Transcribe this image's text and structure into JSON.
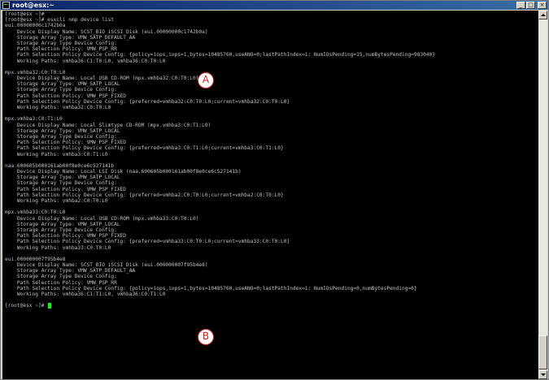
{
  "window": {
    "title": "root@esx:~",
    "buttons": {
      "minimize": "_",
      "maximize": "□",
      "close": "×"
    }
  },
  "terminal": {
    "lines": [
      "[root@esx ~]#",
      "[root@esx ~]# esxcli nmp device list",
      "eui.00000000c1742b0a",
      "    Device Display Name: SCST_BIO iSCSI Disk (eui.00000000c1742b0a)",
      "    Storage Array Type: VMW_SATP_DEFAULT_AA",
      "    Storage Array Type Device Config:",
      "    Path Selection Policy: VMW_PSP_RR",
      "    Path Selection Policy Device Config: {policy=iops,iops=1,bytes=10485760,useANO=0;lastPathIndex=1: NumIOsPending=15,numBytesPending=983040}",
      "    Working Paths: vmhba36:C1:T0:L0, vmhba36:C0:T0:L0",
      "",
      "mpx.vmhba32:C0:T0:L0",
      "    Device Display Name: Local USB CD-ROM (mpx.vmhba32:C0:T0:L0)",
      "    Storage Array Type: VMW_SATP_LOCAL",
      "    Storage Array Type Device Config:",
      "    Path Selection Policy: VMW_PSP_FIXED",
      "    Path Selection Policy Device Config: {preferred=vmhba32:C0:T0:L0;current=vmhba32:C0:T0:L0}",
      "    Working Paths: vmhba32:C0:T0:L0",
      "",
      "mpx.vmhba3:C0:T1:L0",
      "    Device Display Name: Local Slimtype CD-ROM (mpx.vmhba3:C0:T1:L0)",
      "    Storage Array Type: VMW_SATP_LOCAL",
      "    Storage Array Type Device Config:",
      "    Path Selection Policy: VMW_PSP_FIXED",
      "    Path Selection Policy Device Config: {preferred=vmhba3:C0:T1:L0;current=vmhba3:C0:T1:L0}",
      "    Working Paths: vmhba3:C0:T1:L0",
      "",
      "naa.600605b000161ab00f8e0ce6c527141b",
      "    Device Display Name: Local LSI Disk (naa.600605b000161ab00f8e0ce6c527141b)",
      "    Storage Array Type: VMW_SATP_LOCAL",
      "    Storage Array Type Device Config:",
      "    Path Selection Policy: VMW_PSP_FIXED",
      "    Path Selection Policy Device Config: {preferred=vmhba2:C0:T0:L0;current=vmhba2:C0:T0:L0}",
      "    Working Paths: vmhba2:C0:T0:L0",
      "",
      "mpx.vmhba33:C0:T0:L0",
      "    Device Display Name: Local USB CD-ROM (mpx.vmhba33:C0:T0:L0)",
      "    Storage Array Type: VMW_SATP_LOCAL",
      "    Storage Array Type Device Config:",
      "    Path Selection Policy: VMW_PSP_FIXED",
      "    Path Selection Policy Device Config: {preferred=vmhba33:C0:T0:L0;current=vmhba33:C0:T0:L0}",
      "    Working Paths: vmhba33:C0:T0:L0",
      "",
      "eui.000000007f95b4e8",
      "    Device Display Name: SCST_BIO iSCSI Disk (eui.000000007f95b4e8)",
      "    Storage Array Type: VMW_SATP_DEFAULT_AA",
      "    Storage Array Type Device Config:",
      "    Path Selection Policy: VMW_PSP_RR",
      "    Path Selection Policy Device Config: {policy=iops,iops=1,bytes=10485760,useANO=0;lastPathIndex=1: NumIOsPending=0,numBytesPending=0}",
      "    Working Paths: vmhba36:C1:T1:L0, vmhba36:C0:T1:L0",
      "",
      "[root@esx ~]#"
    ]
  },
  "callouts": {
    "a": "A",
    "b": "B"
  },
  "colors": {
    "cursor": "#00ff00",
    "callout": "#d02020",
    "titlebar": "#0a246a"
  }
}
